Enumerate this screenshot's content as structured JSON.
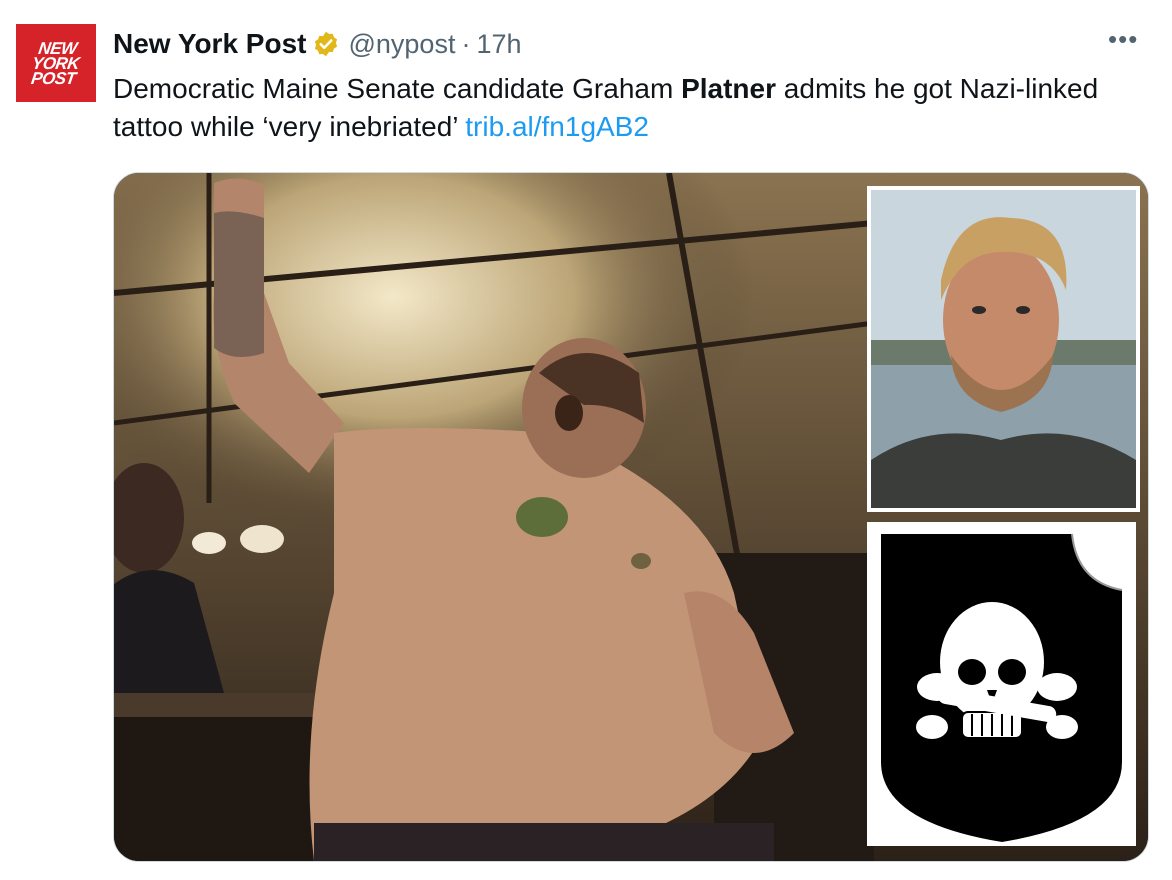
{
  "account": {
    "avatar_text": "NEW\nYORK\nPOST",
    "name": "New York Post",
    "handle": "@nypost",
    "separator": "·",
    "time": "17h",
    "more": "•••",
    "brand_color": "#d6232a",
    "verified_color": "#e2b719"
  },
  "tweet": {
    "text_before": "Democratic Maine Senate candidate Graham ",
    "text_bold": "Platner",
    "text_after": " admits he got Nazi-linked tattoo while ‘very inebriated’ ",
    "link": "trib.al/fn1gAB2",
    "link_color": "#1d9bf0"
  }
}
